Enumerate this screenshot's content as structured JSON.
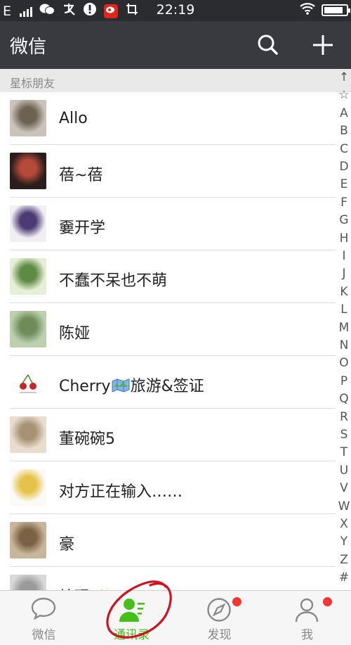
{
  "status_bar": {
    "carrier": "E",
    "time": "22:19",
    "icons": [
      "signal-icon",
      "wechat-icon",
      "alipay-icon",
      "alert-icon",
      "weibo-icon",
      "screenshot-icon",
      "wifi-icon",
      "battery-icon"
    ],
    "battery_level": 0.85
  },
  "header": {
    "title": "微信",
    "icons": [
      "search-icon",
      "plus-icon"
    ]
  },
  "section": {
    "label": "星标朋友"
  },
  "contacts": [
    {
      "name": "Allo",
      "avatar": "cat-photo",
      "avatar_colors": [
        "#c9c3b9",
        "#6d6152"
      ]
    },
    {
      "name": "蓓~蓓",
      "avatar": "selfie-dark",
      "avatar_colors": [
        "#2b1d1b",
        "#b54a3a"
      ]
    },
    {
      "name": "嫑开学",
      "avatar": "anime-character",
      "avatar_colors": [
        "#f1eef4",
        "#4b3a73"
      ]
    },
    {
      "name": "不蠢不呆也不萌",
      "avatar": "girl-photo",
      "avatar_colors": [
        "#e6f0d6",
        "#5d8a44"
      ]
    },
    {
      "name": "陈娅",
      "avatar": "outdoor-photo",
      "avatar_colors": [
        "#bcd0b0",
        "#6e8b58"
      ]
    },
    {
      "name": "Cherry",
      "name_icon": "map-icon",
      "name_suffix": "旅游&签证",
      "avatar": "cherry-logo",
      "avatar_colors": [
        "#ffffff",
        "#c62828"
      ]
    },
    {
      "name": "董碗碗5",
      "avatar": "plush-toy",
      "avatar_colors": [
        "#e9ddcf",
        "#a89276"
      ]
    },
    {
      "name": "对方正在输入……",
      "avatar": "cartoon-girl",
      "avatar_colors": [
        "#fbfaf4",
        "#e6c24a"
      ]
    },
    {
      "name": "豪",
      "avatar": "cartoon-sketch",
      "avatar_colors": [
        "#c9b59a",
        "#7b6245"
      ]
    },
    {
      "name": "焯琨",
      "name_suffix": "✨",
      "avatar": "grey-photo",
      "avatar_colors": [
        "#d8d8d8",
        "#9a9a9a"
      ]
    }
  ],
  "index_bar": [
    "↑",
    "☆",
    "A",
    "B",
    "C",
    "D",
    "E",
    "F",
    "G",
    "H",
    "I",
    "J",
    "K",
    "L",
    "M",
    "N",
    "O",
    "P",
    "Q",
    "R",
    "S",
    "T",
    "U",
    "V",
    "W",
    "X",
    "Y",
    "Z",
    "#"
  ],
  "tab_bar": {
    "active": "contacts",
    "tabs": [
      {
        "id": "chats",
        "label": "微信",
        "icon": "chat-bubble-icon",
        "badge": false
      },
      {
        "id": "contacts",
        "label": "通讯录",
        "icon": "contacts-icon",
        "badge": false
      },
      {
        "id": "discover",
        "label": "发现",
        "icon": "compass-icon",
        "badge": true
      },
      {
        "id": "me",
        "label": "我",
        "icon": "person-icon",
        "badge": true
      }
    ]
  },
  "colors": {
    "header_bg": "#393a3f",
    "accent": "#45c01a",
    "badge": "#f43530",
    "annotation_circle": "#d0141e"
  }
}
